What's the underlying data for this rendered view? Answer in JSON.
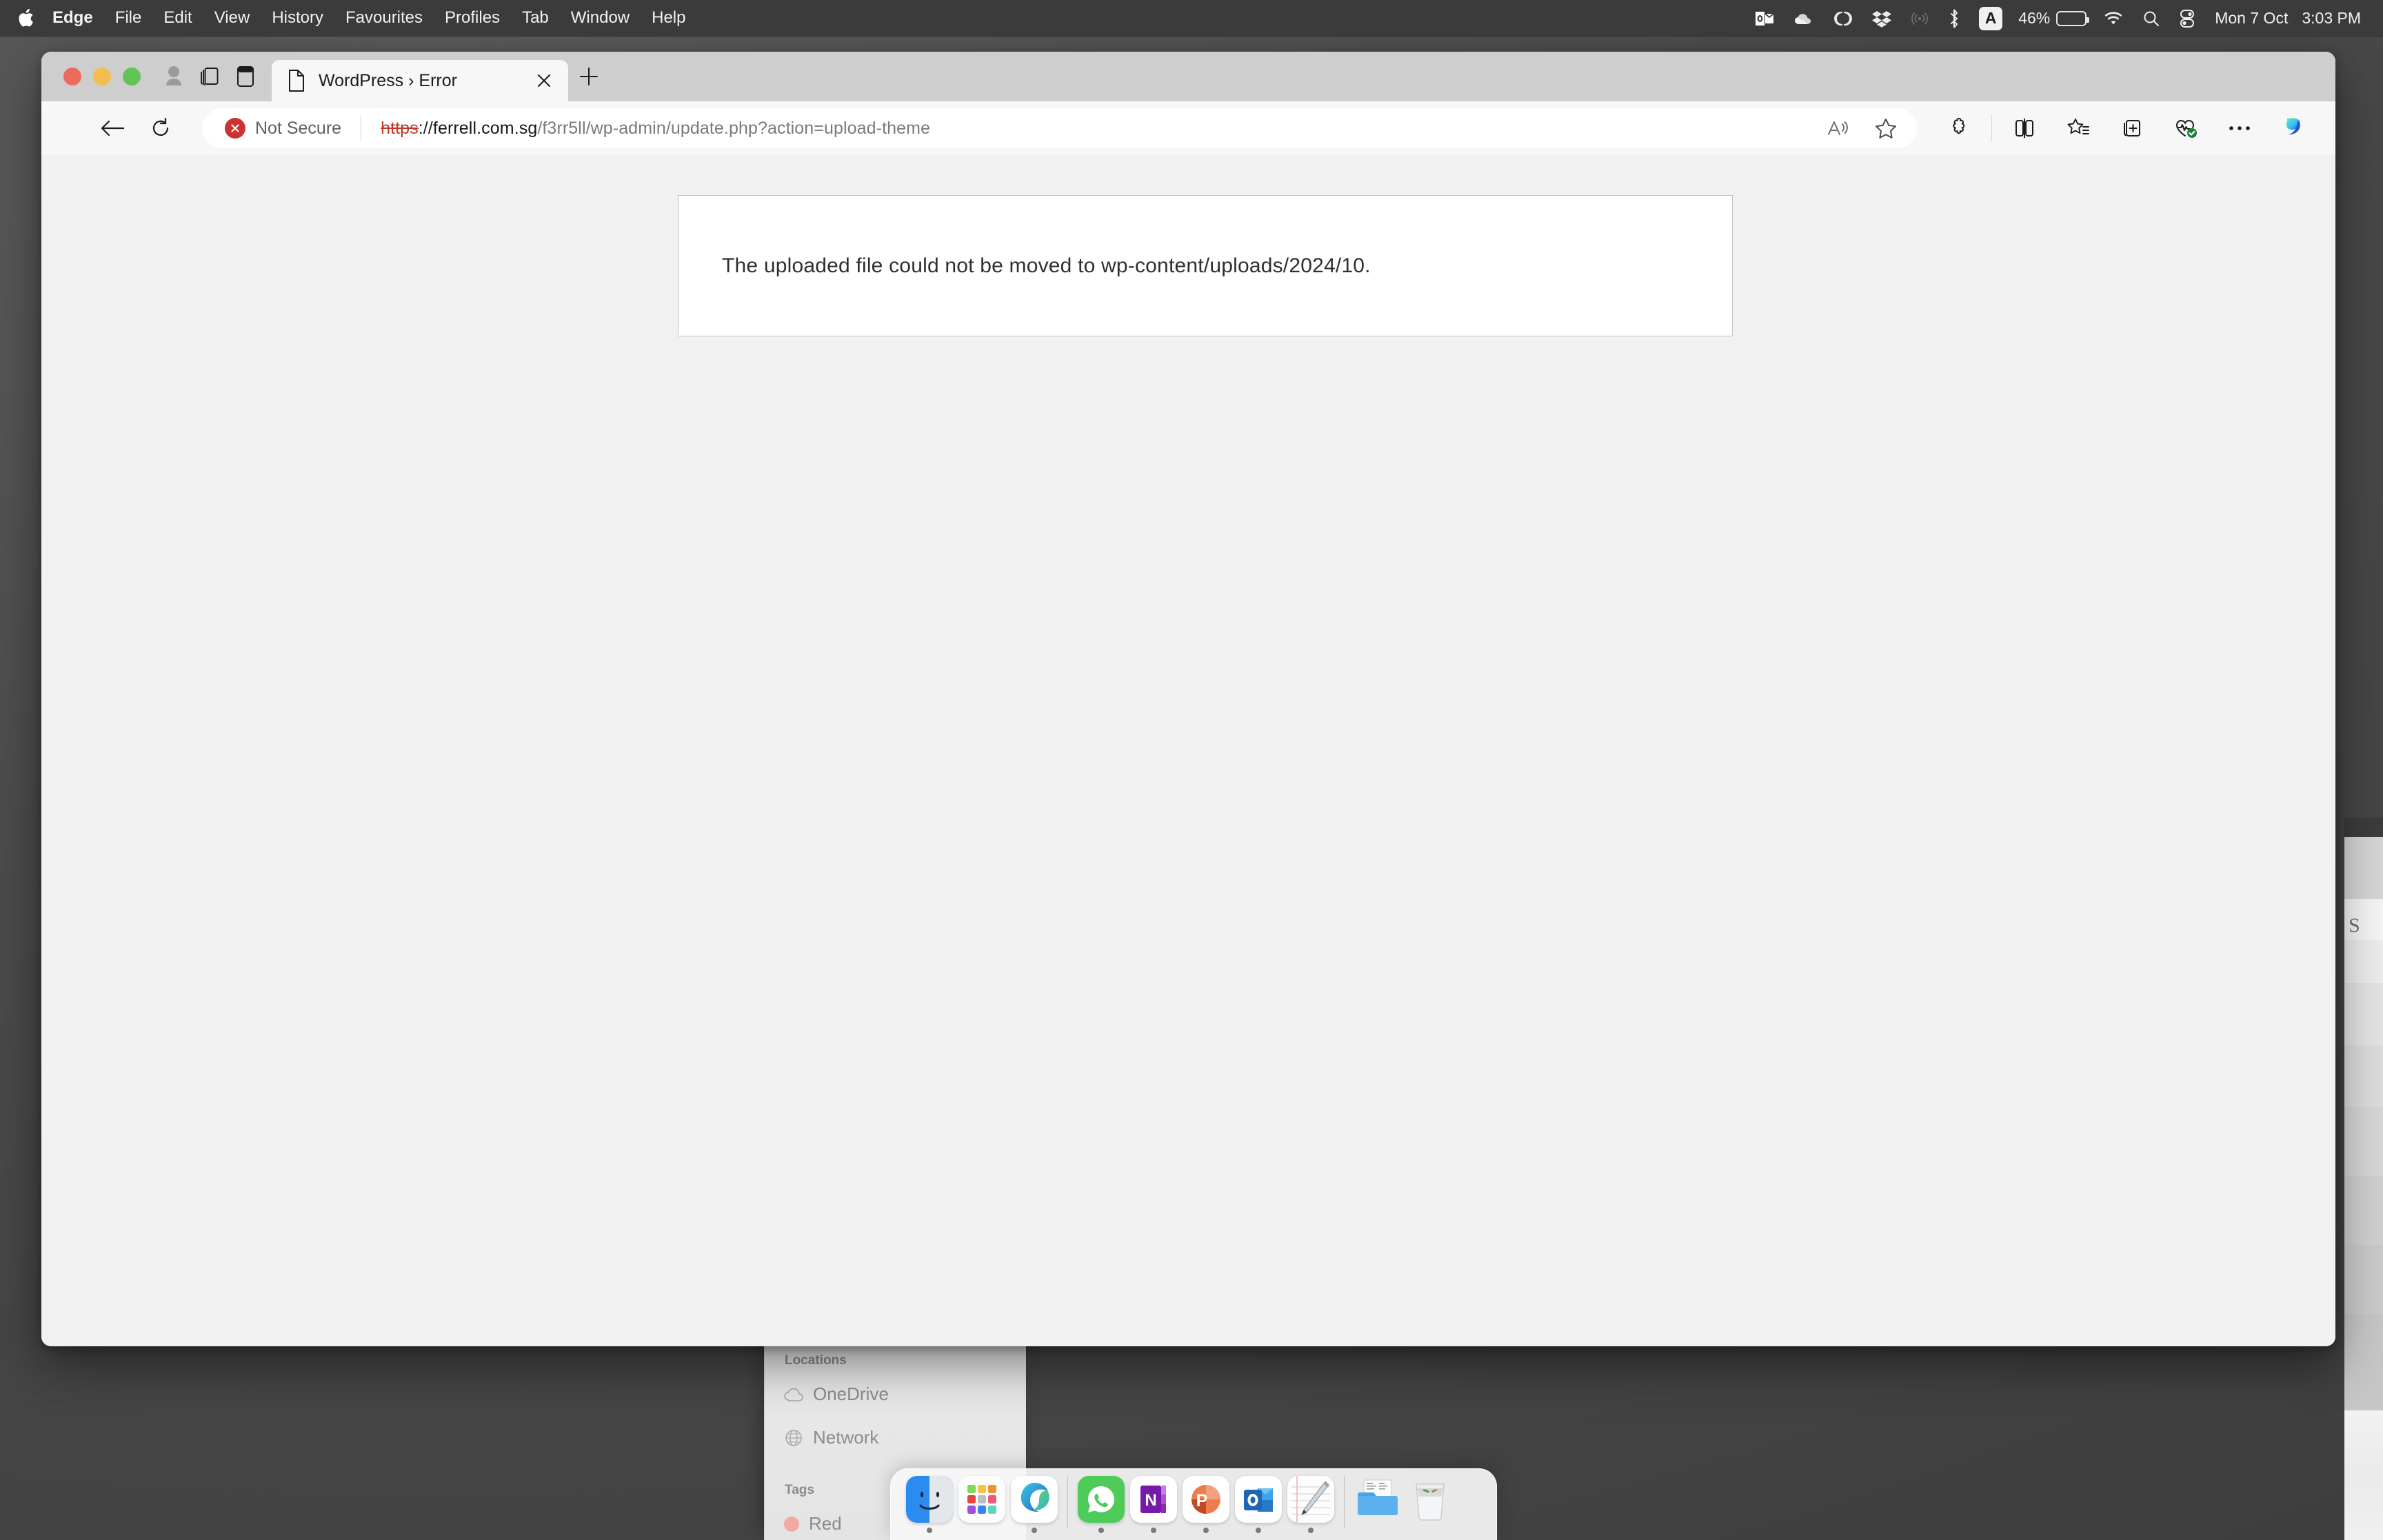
{
  "menubar": {
    "apple_icon": "apple-logo-icon",
    "items": [
      {
        "label": "Edge",
        "bold": true
      },
      {
        "label": "File",
        "bold": false
      },
      {
        "label": "Edit",
        "bold": false
      },
      {
        "label": "View",
        "bold": false
      },
      {
        "label": "History",
        "bold": false
      },
      {
        "label": "Favourites",
        "bold": false
      },
      {
        "label": "Profiles",
        "bold": false
      },
      {
        "label": "Tab",
        "bold": false
      },
      {
        "label": "Window",
        "bold": false
      },
      {
        "label": "Help",
        "bold": false
      }
    ],
    "tray": {
      "icons": [
        "outlook-icon",
        "onedrive-icon",
        "adobe-creative-cloud-icon",
        "dropbox-icon",
        "airplay-icon",
        "bluetooth-icon"
      ],
      "input_source": "A",
      "battery_percent": "46%",
      "battery_level": 46,
      "wifi_icon": "wifi-icon",
      "search_icon": "spotlight-search-icon",
      "control_center_icon": "control-center-icon",
      "date": "Mon 7 Oct",
      "time": "3:03 PM"
    }
  },
  "browser": {
    "window_controls": [
      "close",
      "minimize",
      "maximize"
    ],
    "toolbar_left_icons": [
      "profile-avatar-icon",
      "workspaces-icon",
      "tab-actions-icon"
    ],
    "tab": {
      "favicon": "page-document-icon",
      "title": "WordPress › Error",
      "close_label": "✕"
    },
    "new_tab_label": "+",
    "nav": {
      "back_icon": "back-arrow-icon",
      "reload_icon": "reload-icon"
    },
    "omnibox": {
      "security_badge": "Not Secure",
      "security_icon": "not-secure-icon",
      "url_scheme": "https",
      "url_separator": "://",
      "url_host": "ferrell.com.sg",
      "url_path": "/f3rr5ll/wp-admin/update.php?action=upload-theme",
      "full_url": "https://ferrell.com.sg/f3rr5ll/wp-admin/update.php?action=upload-theme",
      "read_aloud_icon": "read-aloud-icon",
      "favorite_icon": "star-favorite-icon"
    },
    "toolbar_right_icons": [
      "copilot-puzzle-icon",
      "split-screen-icon",
      "favorites-list-icon",
      "collections-icon",
      "browser-essentials-icon",
      "more-options-icon",
      "copilot-icon"
    ]
  },
  "page": {
    "error_message": "The uploaded file could not be moved to wp-content/uploads/2024/10."
  },
  "finder": {
    "sections": [
      {
        "header": "Locations",
        "items": [
          {
            "label": "OneDrive",
            "icon": "cloud-icon"
          },
          {
            "label": "Network",
            "icon": "globe-icon"
          }
        ]
      },
      {
        "header": "Tags",
        "items": [
          {
            "label": "Red",
            "icon": "red-tag-dot"
          }
        ]
      }
    ]
  },
  "behind_window": {
    "visible_text": "S"
  },
  "dock": {
    "items": [
      {
        "name": "finder",
        "label": "Finder",
        "running": true
      },
      {
        "name": "launchpad",
        "label": "Launchpad",
        "running": false
      },
      {
        "name": "microsoft-edge",
        "label": "Microsoft Edge",
        "running": true
      },
      {
        "name": "whatsapp",
        "label": "WhatsApp",
        "running": true
      },
      {
        "name": "onenote",
        "label": "OneNote",
        "running": true
      },
      {
        "name": "powerpoint",
        "label": "PowerPoint",
        "running": true
      },
      {
        "name": "outlook",
        "label": "Outlook",
        "running": true
      },
      {
        "name": "notes",
        "label": "Notes",
        "running": true
      },
      {
        "name": "downloads-folder",
        "label": "Downloads",
        "running": false
      },
      {
        "name": "trash",
        "label": "Trash",
        "running": false
      }
    ]
  },
  "colors": {
    "menubar_bg": "#3b3b3b",
    "desktop_bg": "#4a4a4a",
    "tabstrip_bg": "#cecece",
    "toolbar_bg": "#f7f7f7",
    "page_bg": "#f1f1f1",
    "card_border": "#c3c4c7",
    "not_secure_red": "#cc3232",
    "url_strike_red": "#c0392b"
  }
}
